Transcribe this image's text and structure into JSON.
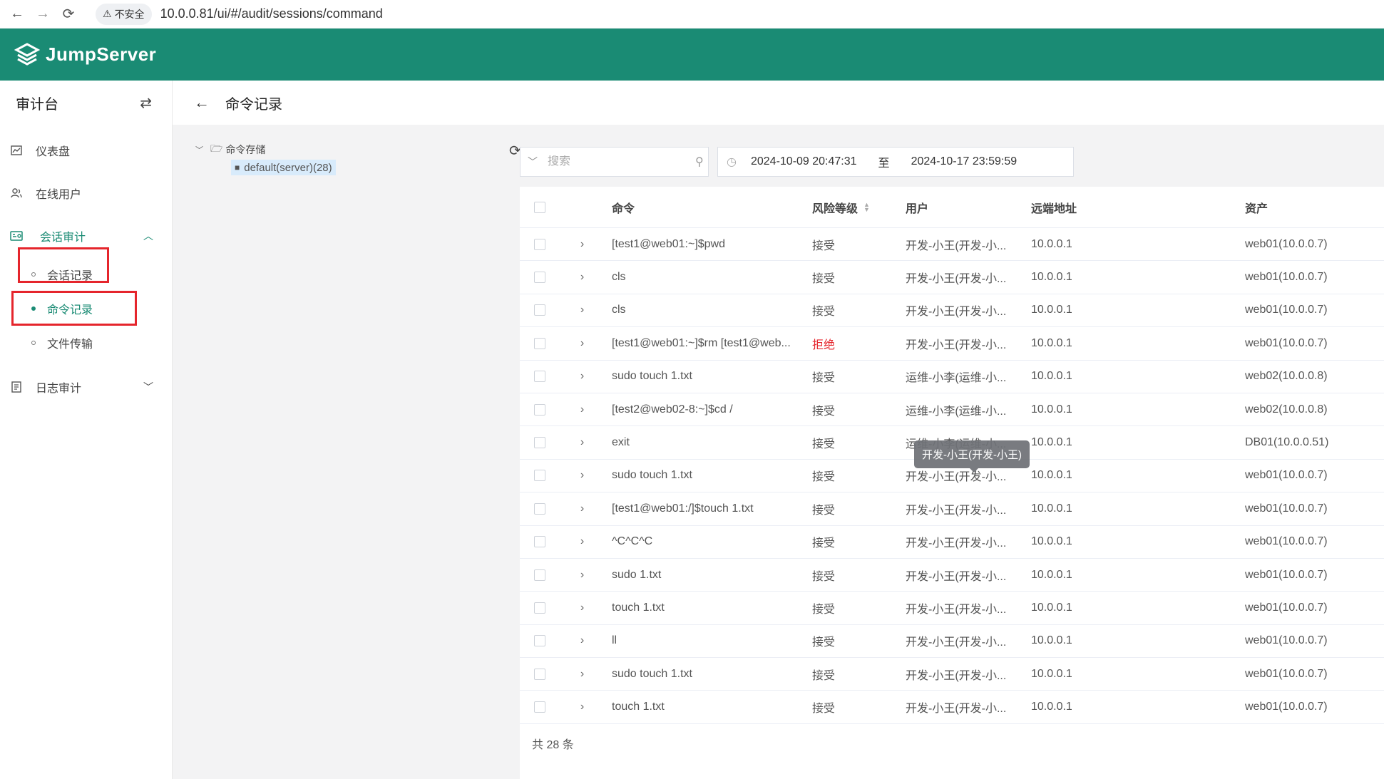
{
  "browser": {
    "back": "←",
    "forward": "→",
    "reload": "⟳",
    "security_label": "不安全",
    "url": "10.0.0.81/ui/#/audit/sessions/command"
  },
  "app": {
    "name": "JumpServer",
    "brand_color": "#1a8b74"
  },
  "sidebar": {
    "title": "审计台",
    "menu": {
      "dashboard": "仪表盘",
      "online_users": "在线用户",
      "session_audit": "会话审计",
      "log_audit": "日志审计"
    },
    "session_sub": {
      "sessions": "会话记录",
      "commands": "命令记录",
      "file_transfer": "文件传输"
    }
  },
  "page": {
    "title": "命令记录"
  },
  "tree": {
    "root": "命令存储",
    "child": "default(server)(28)"
  },
  "filters": {
    "search_placeholder": "搜索",
    "date_from": "2024-10-09 20:47:31",
    "date_sep": "至",
    "date_to": "2024-10-17 23:59:59"
  },
  "table": {
    "headers": {
      "command": "命令",
      "risk": "风险等级",
      "user": "用户",
      "remote_addr": "远端地址",
      "asset": "资产"
    },
    "rows": [
      {
        "command": "[test1@web01:~]$pwd",
        "risk": "接受",
        "user": "开发-小王(开发-小...",
        "addr": "10.0.0.1",
        "asset": "web01(10.0.0.7)"
      },
      {
        "command": "cls",
        "risk": "接受",
        "user": "开发-小王(开发-小...",
        "addr": "10.0.0.1",
        "asset": "web01(10.0.0.7)"
      },
      {
        "command": "cls",
        "risk": "接受",
        "user": "开发-小王(开发-小...",
        "addr": "10.0.0.1",
        "asset": "web01(10.0.0.7)"
      },
      {
        "command": "[test1@web01:~]$rm [test1@web...",
        "risk": "拒绝",
        "user": "开发-小王(开发-小...",
        "addr": "10.0.0.1",
        "asset": "web01(10.0.0.7)"
      },
      {
        "command": "sudo touch 1.txt",
        "risk": "接受",
        "user": "运维-小李(运维-小...",
        "addr": "10.0.0.1",
        "asset": "web02(10.0.0.8)"
      },
      {
        "command": "[test2@web02-8:~]$cd /",
        "risk": "接受",
        "user": "运维-小李(运维-小...",
        "addr": "10.0.0.1",
        "asset": "web02(10.0.0.8)"
      },
      {
        "command": "exit",
        "risk": "接受",
        "user": "运维-小李(运维-小...",
        "addr": "10.0.0.1",
        "asset": "DB01(10.0.0.51)"
      },
      {
        "command": "sudo touch 1.txt",
        "risk": "接受",
        "user": "开发-小王(开发-小...",
        "addr": "10.0.0.1",
        "asset": "web01(10.0.0.7)"
      },
      {
        "command": "[test1@web01:/]$touch 1.txt",
        "risk": "接受",
        "user": "开发-小王(开发-小...",
        "addr": "10.0.0.1",
        "asset": "web01(10.0.0.7)"
      },
      {
        "command": "^C^C^C",
        "risk": "接受",
        "user": "开发-小王(开发-小...",
        "addr": "10.0.0.1",
        "asset": "web01(10.0.0.7)"
      },
      {
        "command": "sudo 1.txt",
        "risk": "接受",
        "user": "开发-小王(开发-小...",
        "addr": "10.0.0.1",
        "asset": "web01(10.0.0.7)"
      },
      {
        "command": "touch 1.txt",
        "risk": "接受",
        "user": "开发-小王(开发-小...",
        "addr": "10.0.0.1",
        "asset": "web01(10.0.0.7)"
      },
      {
        "command": "ll",
        "risk": "接受",
        "user": "开发-小王(开发-小...",
        "addr": "10.0.0.1",
        "asset": "web01(10.0.0.7)"
      },
      {
        "command": "sudo touch 1.txt",
        "risk": "接受",
        "user": "开发-小王(开发-小...",
        "addr": "10.0.0.1",
        "asset": "web01(10.0.0.7)"
      },
      {
        "command": "touch 1.txt",
        "risk": "接受",
        "user": "开发-小王(开发-小...",
        "addr": "10.0.0.1",
        "asset": "web01(10.0.0.7)"
      }
    ],
    "total": "共 28 条",
    "tooltip": "开发-小王(开发-小王)"
  },
  "colors": {
    "danger": "#e5252c",
    "highlight_box": "#e5252c"
  }
}
